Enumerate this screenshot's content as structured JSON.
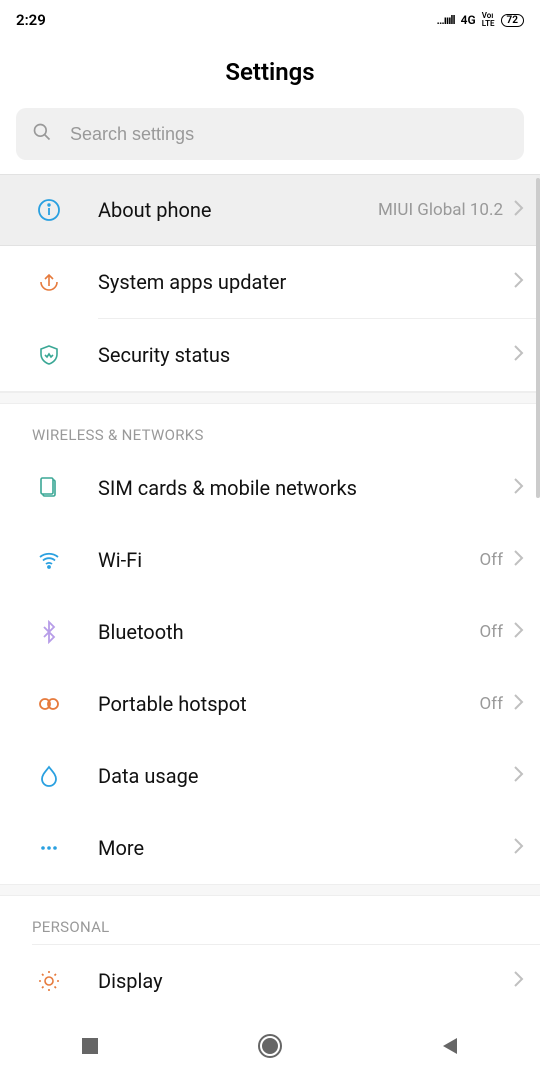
{
  "status_bar": {
    "time": "2:29",
    "signal_text": "...ıııll",
    "net": "4G",
    "volte": "Voı\nLTE",
    "battery": "72"
  },
  "header": {
    "title": "Settings"
  },
  "search": {
    "placeholder": "Search settings"
  },
  "section1": {
    "about": {
      "label": "About phone",
      "value": "MIUI Global 10.2"
    },
    "updater": {
      "label": "System apps updater"
    },
    "security": {
      "label": "Security status"
    }
  },
  "wireless": {
    "header": "WIRELESS & NETWORKS",
    "sim": {
      "label": "SIM cards & mobile networks"
    },
    "wifi": {
      "label": "Wi-Fi",
      "value": "Off"
    },
    "bluetooth": {
      "label": "Bluetooth",
      "value": "Off"
    },
    "hotspot": {
      "label": "Portable hotspot",
      "value": "Off"
    },
    "data": {
      "label": "Data usage"
    },
    "more": {
      "label": "More"
    }
  },
  "personal": {
    "header": "PERSONAL",
    "display": {
      "label": "Display"
    }
  }
}
